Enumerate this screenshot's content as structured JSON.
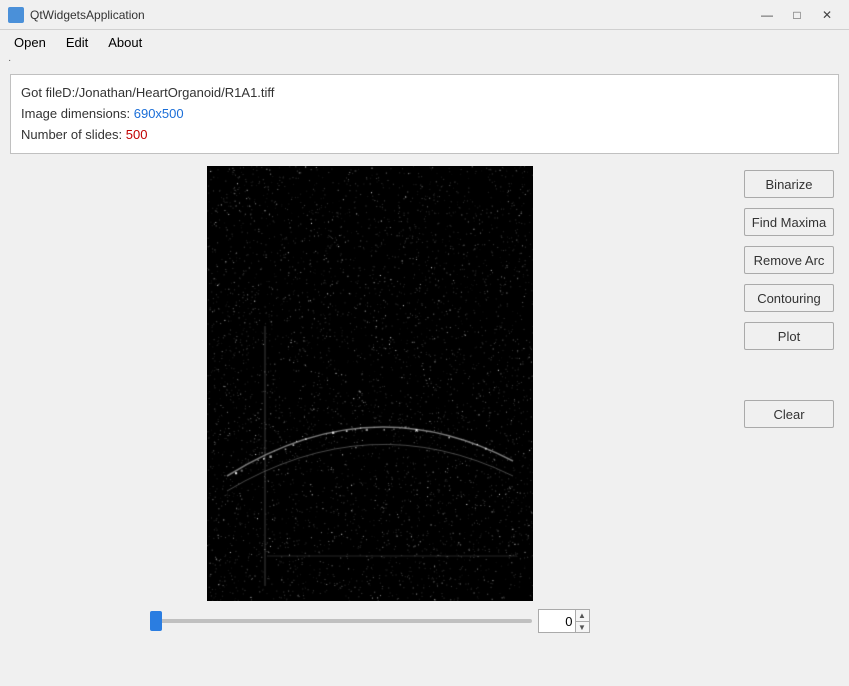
{
  "titleBar": {
    "icon": "app-icon",
    "title": "QtWidgetsApplication",
    "minimizeLabel": "—",
    "maximizeLabel": "□",
    "closeLabel": "✕"
  },
  "menuBar": {
    "items": [
      {
        "id": "open",
        "label": "Open"
      },
      {
        "id": "edit",
        "label": "Edit"
      },
      {
        "id": "about",
        "label": "About"
      }
    ]
  },
  "dot": "·",
  "infoBox": {
    "line1": "Got fileD:/Jonathan/HeartOrganoid/R1A1.tiff",
    "line2_prefix": "Image dimensions: ",
    "line2_value": "690x500",
    "line3_prefix": "Number of slides: ",
    "line3_value": "500"
  },
  "buttons": {
    "binarize": "Binarize",
    "findMaxima": "Find Maxima",
    "removeArc": "Remove Arc",
    "contouring": "Contouring",
    "plot": "Plot",
    "clear": "Clear"
  },
  "slider": {
    "value": "0",
    "min": 0,
    "max": 499
  }
}
